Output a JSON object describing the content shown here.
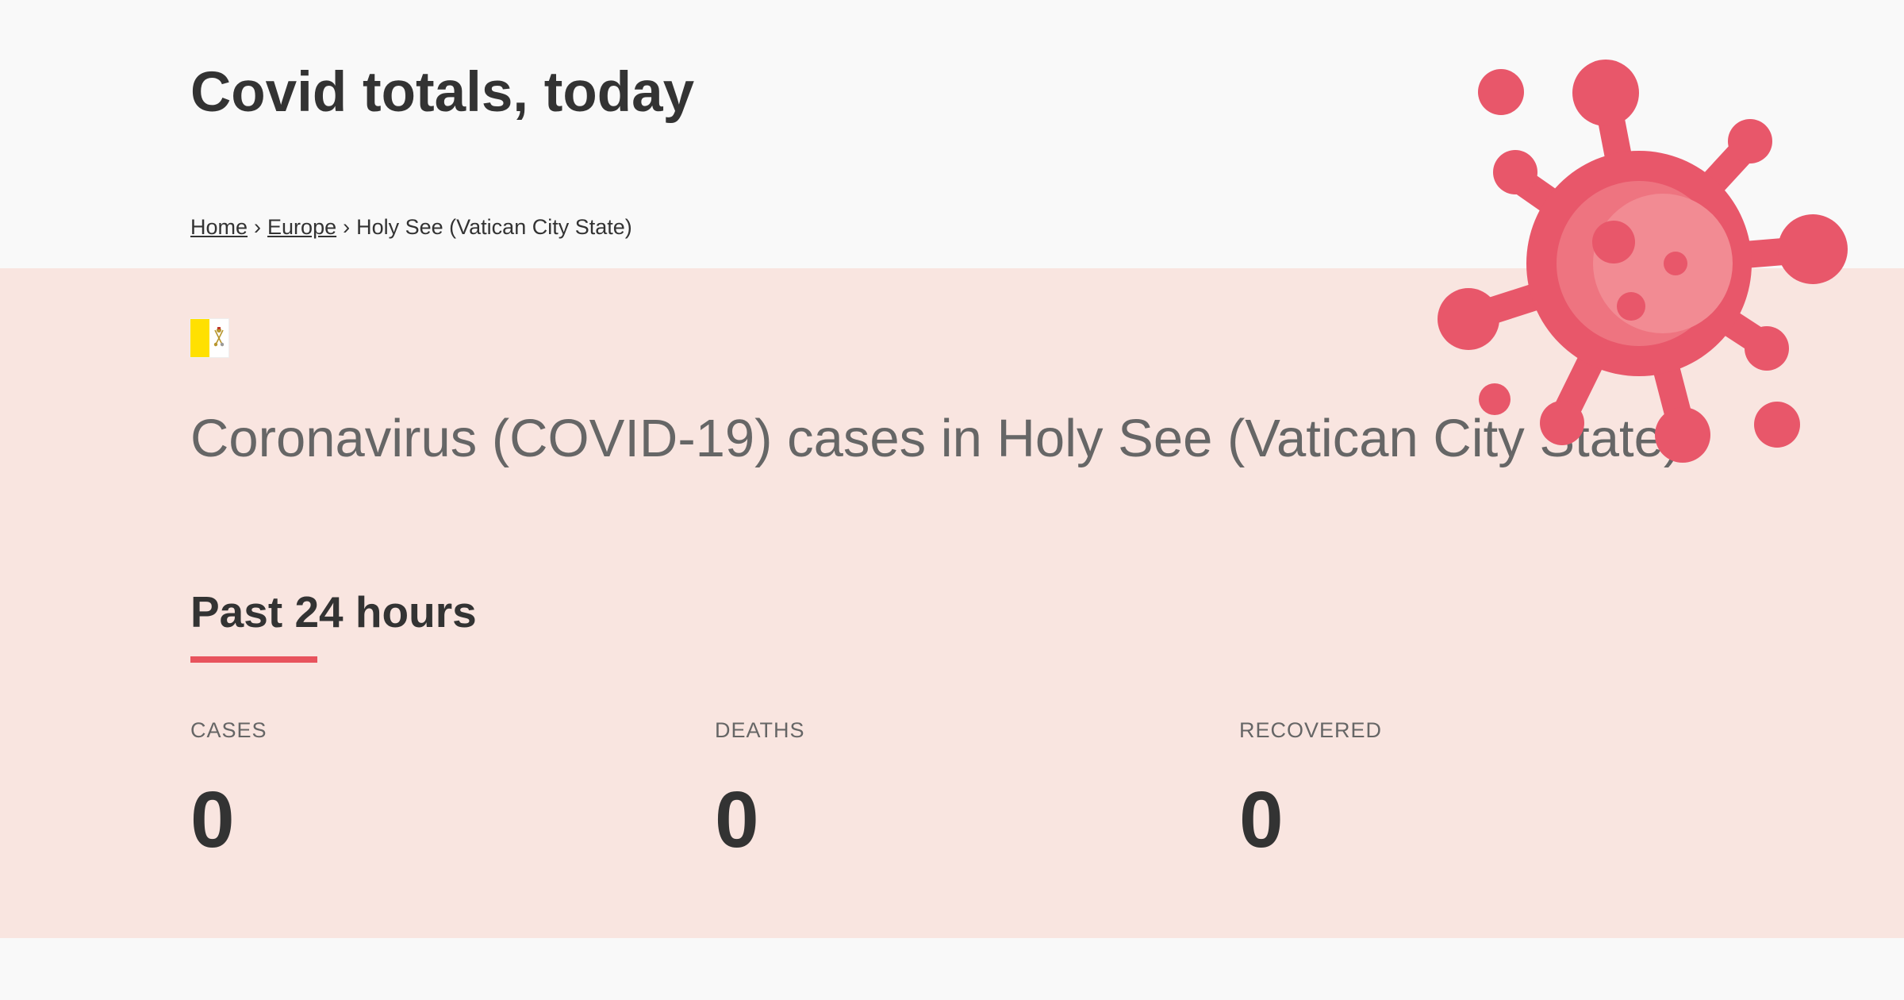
{
  "header": {
    "title": "Covid totals, today"
  },
  "breadcrumb": {
    "home": "Home",
    "region": "Europe",
    "separator": "›",
    "current": "Holy See (Vatican City State)"
  },
  "country": {
    "flag_icon": "vatican-flag-icon",
    "heading": "Coronavirus (COVID-19) cases in Holy See (Vatican City State)"
  },
  "past24": {
    "title": "Past 24 hours",
    "accent_color": "#e8535d",
    "stats": [
      {
        "label": "CASES",
        "value": "0"
      },
      {
        "label": "DEATHS",
        "value": "0"
      },
      {
        "label": "RECOVERED",
        "value": "0"
      }
    ]
  },
  "decoration": {
    "virus_icon": "coronavirus-icon",
    "virus_color": "#e8576a",
    "band_color": "#f9e5e0"
  }
}
